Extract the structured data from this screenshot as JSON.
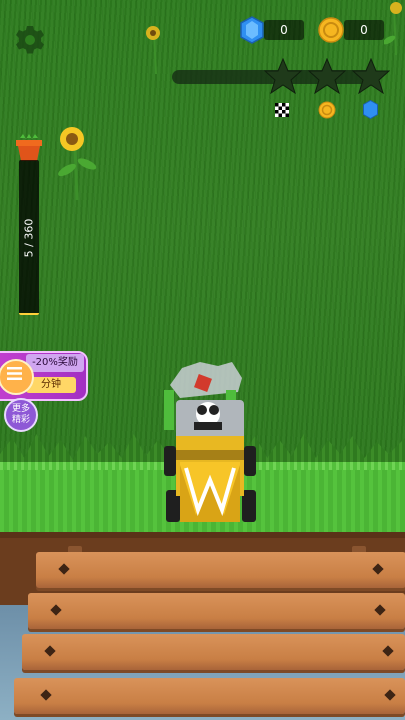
{
  "hud": {
    "gems": "0",
    "coins": "0",
    "level_progress": 0,
    "stars_earned": 0,
    "stars_total": 3,
    "reward_icons": [
      "checkered-flag-icon",
      "coin-icon",
      "gem-icon"
    ]
  },
  "storage": {
    "label": "5 / 360",
    "current": 5,
    "capacity": 360
  },
  "bonus": {
    "top_text": "-20%奖励",
    "bottom_text": "分钟"
  },
  "more_button": {
    "line1": "更多",
    "line2": "精彩"
  },
  "colors": {
    "grass_tall": "#2e7d1f",
    "grass_cut": "#55c33d",
    "accent_yellow": "#ffd23a",
    "gem_blue": "#3fa0ff",
    "coin_gold": "#f6b620",
    "bonus_purple": "#b137c9"
  }
}
